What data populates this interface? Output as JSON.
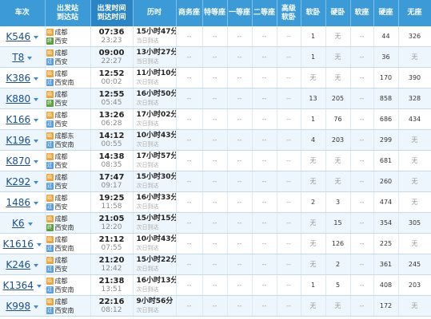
{
  "headers": {
    "train": "车次",
    "station_top": "出发站",
    "station_bottom": "到达站",
    "time_top": "出发时间",
    "time_bottom": "到达时间",
    "duration": "历时",
    "business": "商务座",
    "special": "特等座",
    "first": "一等座",
    "second": "二等座",
    "deluxe_soft_top": "高级",
    "deluxe_soft_bottom": "软卧",
    "soft_sleeper": "软卧",
    "hard_sleeper": "硬卧",
    "soft_seat": "软座",
    "hard_seat": "硬座",
    "no_seat": "无座"
  },
  "icons": {
    "start": "始",
    "pass": "过",
    "end": "终"
  },
  "rows": [
    {
      "train": "K546",
      "from": "成都",
      "from_icon": "start",
      "to": "西安",
      "to_icon": "end",
      "dep": "07:36",
      "arr": "23:23",
      "duration": "15小时47分",
      "note": "当日到达",
      "seats": [
        "--",
        "--",
        "--",
        "--",
        "--",
        "1",
        "无",
        "--",
        "44",
        "326"
      ]
    },
    {
      "train": "T8",
      "from": "成都",
      "from_icon": "start",
      "to": "西安",
      "to_icon": "pass",
      "dep": "09:00",
      "arr": "22:27",
      "duration": "13小时27分",
      "note": "当日到达",
      "seats": [
        "--",
        "--",
        "--",
        "--",
        "--",
        "1",
        "无",
        "--",
        "36",
        "无"
      ]
    },
    {
      "train": "K386",
      "from": "成都",
      "from_icon": "start",
      "to": "西安南",
      "to_icon": "pass",
      "dep": "12:52",
      "arr": "00:02",
      "duration": "11小时10分",
      "note": "次日到达",
      "seats": [
        "--",
        "--",
        "--",
        "--",
        "--",
        "无",
        "无",
        "--",
        "170",
        "390"
      ]
    },
    {
      "train": "K880",
      "from": "成都",
      "from_icon": "start",
      "to": "西安",
      "to_icon": "end",
      "dep": "12:55",
      "arr": "05:45",
      "duration": "16小时50分",
      "note": "次日到达",
      "seats": [
        "--",
        "--",
        "--",
        "--",
        "--",
        "13",
        "205",
        "--",
        "858",
        "328"
      ]
    },
    {
      "train": "K166",
      "from": "成都",
      "from_icon": "start",
      "to": "西安",
      "to_icon": "pass",
      "dep": "13:26",
      "arr": "06:28",
      "duration": "17小时02分",
      "note": "次日到达",
      "seats": [
        "--",
        "--",
        "--",
        "--",
        "--",
        "1",
        "76",
        "--",
        "686",
        "434"
      ]
    },
    {
      "train": "K196",
      "from": "成都东",
      "from_icon": "start",
      "to": "西安南",
      "to_icon": "pass",
      "dep": "14:12",
      "arr": "00:55",
      "duration": "10小时43分",
      "note": "次日到达",
      "seats": [
        "--",
        "--",
        "--",
        "--",
        "--",
        "4",
        "203",
        "--",
        "299",
        "无"
      ]
    },
    {
      "train": "K870",
      "from": "成都",
      "from_icon": "start",
      "to": "西安",
      "to_icon": "pass",
      "dep": "14:38",
      "arr": "08:35",
      "duration": "17小时57分",
      "note": "次日到达",
      "seats": [
        "--",
        "--",
        "--",
        "--",
        "--",
        "无",
        "无",
        "--",
        "681",
        "无"
      ]
    },
    {
      "train": "K292",
      "from": "成都",
      "from_icon": "start",
      "to": "西安",
      "to_icon": "pass",
      "dep": "17:47",
      "arr": "09:17",
      "duration": "15小时30分",
      "note": "次日到达",
      "seats": [
        "--",
        "--",
        "--",
        "--",
        "--",
        "无",
        "无",
        "--",
        "260",
        "无"
      ]
    },
    {
      "train": "1486",
      "from": "成都",
      "from_icon": "start",
      "to": "西安",
      "to_icon": "pass",
      "dep": "19:25",
      "arr": "11:58",
      "duration": "16小时33分",
      "note": "次日到达",
      "seats": [
        "--",
        "--",
        "--",
        "--",
        "--",
        "2",
        "3",
        "--",
        "474",
        "无"
      ]
    },
    {
      "train": "K6",
      "from": "成都",
      "from_icon": "start",
      "to": "西安南",
      "to_icon": "end",
      "dep": "21:05",
      "arr": "12:20",
      "duration": "15小时15分",
      "note": "次日到达",
      "seats": [
        "--",
        "--",
        "--",
        "--",
        "--",
        "无",
        "15",
        "--",
        "354",
        "305"
      ]
    },
    {
      "train": "K1616",
      "from": "成都",
      "from_icon": "start",
      "to": "西安南",
      "to_icon": "pass",
      "dep": "21:12",
      "arr": "07:55",
      "duration": "10小时43分",
      "note": "次日到达",
      "seats": [
        "--",
        "--",
        "--",
        "--",
        "--",
        "无",
        "126",
        "--",
        "225",
        "无"
      ]
    },
    {
      "train": "K246",
      "from": "成都",
      "from_icon": "start",
      "to": "西安",
      "to_icon": "pass",
      "dep": "21:20",
      "arr": "12:42",
      "duration": "15小时22分",
      "note": "次日到达",
      "seats": [
        "--",
        "--",
        "--",
        "--",
        "--",
        "无",
        "2",
        "--",
        "361",
        "245"
      ]
    },
    {
      "train": "K1364",
      "from": "成都",
      "from_icon": "start",
      "to": "西安南",
      "to_icon": "pass",
      "dep": "21:38",
      "arr": "13:51",
      "duration": "16小时13分",
      "note": "次日到达",
      "seats": [
        "--",
        "--",
        "--",
        "--",
        "--",
        "1",
        "5",
        "--",
        "408",
        "203"
      ]
    },
    {
      "train": "K998",
      "from": "成都",
      "from_icon": "start",
      "to": "西安南",
      "to_icon": "pass",
      "dep": "22:16",
      "arr": "08:12",
      "duration": "9小时56分",
      "note": "次日到达",
      "seats": [
        "--",
        "--",
        "--",
        "--",
        "--",
        "无",
        "无",
        "--",
        "172",
        "无"
      ]
    }
  ],
  "colors": {
    "header": "#3c9bd7",
    "alt_row": "#eef6fd",
    "train_link": "#1b4f8a"
  }
}
